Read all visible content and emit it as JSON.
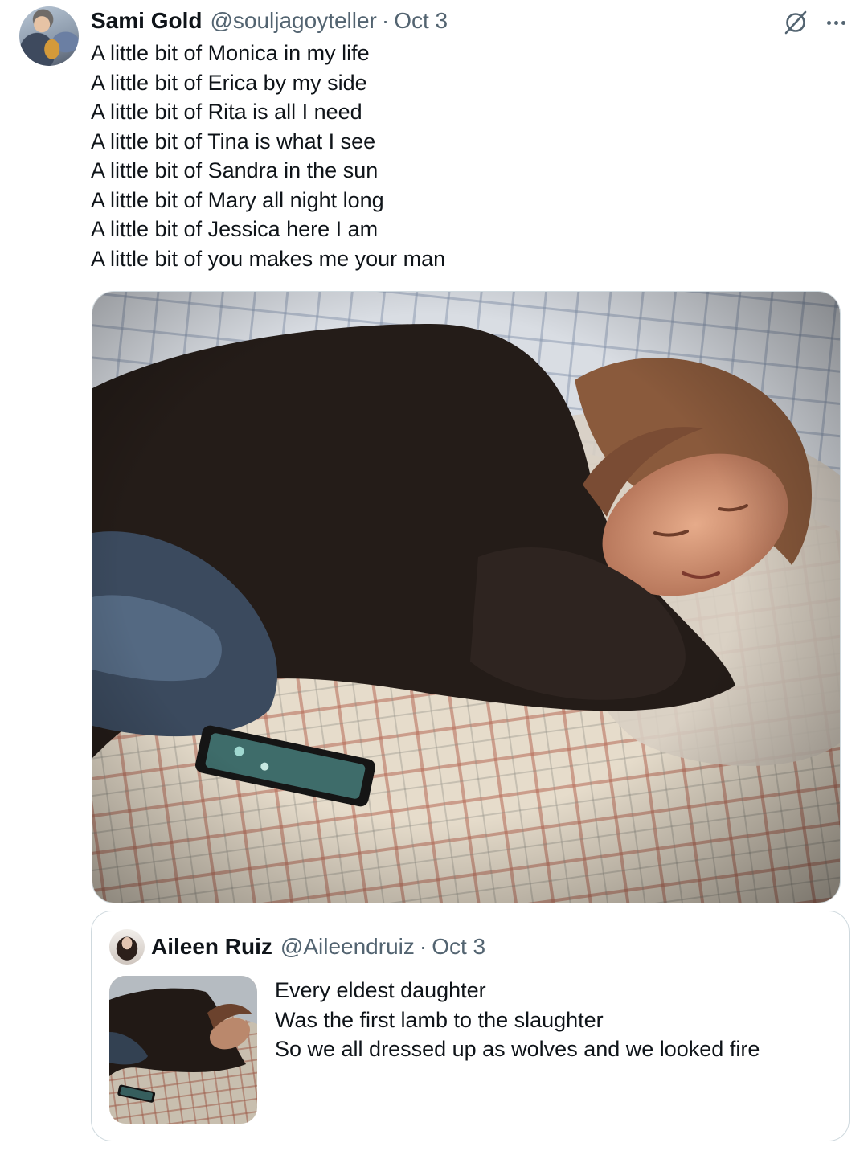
{
  "tweet": {
    "author_name": "Sami Gold",
    "author_handle": "@souljagoyteller",
    "separator": "·",
    "date": "Oct 3",
    "lines": [
      "A little bit of Monica in my life",
      "A little bit of Erica by my side",
      "A little bit of Rita is all I need",
      "A little bit of Tina is what I see",
      "A little bit of Sandra in the sun",
      "A little bit of Mary all night long",
      "A little bit of Jessica here I am",
      "A little bit of you makes me your man"
    ]
  },
  "quoted_tweet": {
    "author_name": "Aileen Ruiz",
    "author_handle": "@Aileendruiz",
    "separator": "·",
    "date": "Oct 3",
    "lines": [
      "Every eldest daughter",
      "Was the first lamb to the slaughter",
      "So we all dressed up as wolves and we looked fire"
    ]
  },
  "icons": {
    "grok": "grok-icon",
    "more": "more-icon"
  },
  "colors": {
    "text_primary": "#0f1419",
    "text_secondary": "#536471",
    "border": "#cfd9de"
  }
}
